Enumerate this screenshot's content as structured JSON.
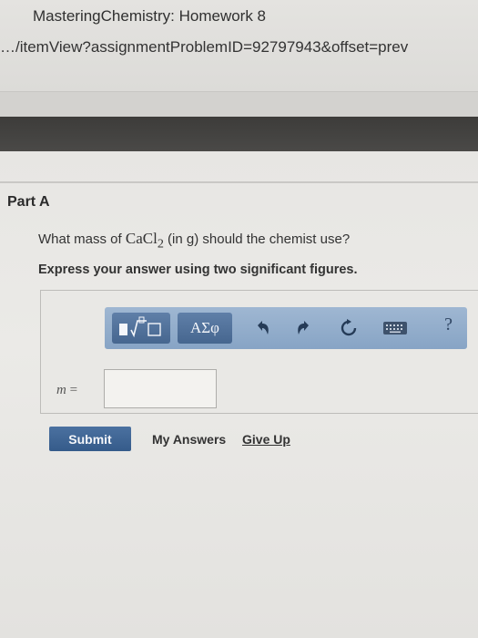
{
  "browser": {
    "tab_title": "MasteringChemistry: Homework 8",
    "url": "…/itemView?assignmentProblemID=92797943&offset=prev"
  },
  "part": {
    "title": "Part A",
    "question_prefix": "What mass of ",
    "question_formula_main": "CaCl",
    "question_formula_sub": "2",
    "question_unit": " (in g)",
    "question_suffix": " should the chemist use?",
    "instruction": "Express your answer using two significant figures."
  },
  "toolbar": {
    "templates_button_icon": "templates-icon",
    "symbols_label": "ΑΣφ",
    "undo_icon": "undo-icon",
    "redo_icon": "redo-icon",
    "reset_icon": "reset-icon",
    "keyboard_icon": "keyboard-icon",
    "help_label": "?"
  },
  "answer": {
    "variable": "m",
    "equals": " =",
    "value": ""
  },
  "actions": {
    "submit_label": "Submit",
    "my_answers_label": "My Answers",
    "give_up_label": "Give Up"
  },
  "colors": {
    "toolbar_bg": "#97afcc",
    "button_bg": "#4e6f98",
    "submit_bg": "#416793",
    "header_bar": "#434240"
  }
}
